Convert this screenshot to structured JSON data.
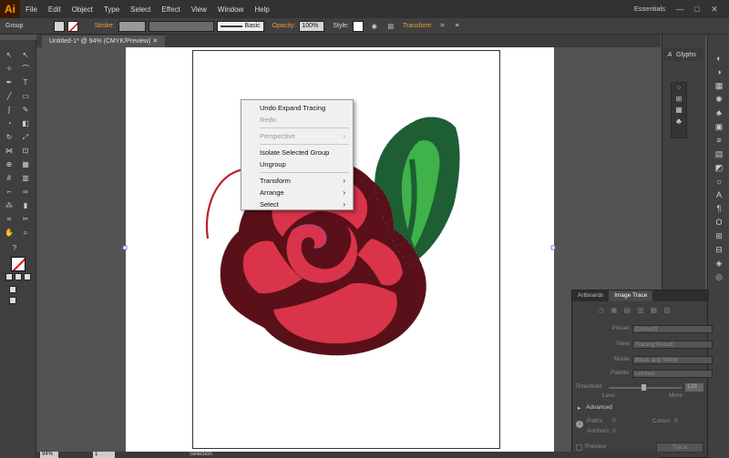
{
  "app": {
    "logo": "Ai",
    "workspace": "Essentials"
  },
  "menu": [
    "File",
    "Edit",
    "Object",
    "Type",
    "Select",
    "Effect",
    "View",
    "Window",
    "Help"
  ],
  "window_controls": [
    "—",
    "□",
    "✕"
  ],
  "control_bar": {
    "selection_type": "Group",
    "stroke_label": "Stroke:",
    "brush_label": "Basic",
    "opacity_label": "Opacity:",
    "opacity_value": "100%",
    "style_label": "Style:",
    "transform_label": "Transform"
  },
  "document_tab": "Untitled-1* @ 94% (CMYK/Preview)",
  "right_panel": {
    "glyphs_label": "Glyphs"
  },
  "context_menu": {
    "items": [
      {
        "label": "Undo Expand Tracing",
        "enabled": true
      },
      {
        "label": "Redo",
        "enabled": false
      },
      {
        "label": "Perspective",
        "enabled": false,
        "submenu": true
      },
      {
        "label": "Isolate Selected Group",
        "enabled": true
      },
      {
        "label": "Ungroup",
        "enabled": true
      },
      {
        "label": "Transform",
        "enabled": true,
        "submenu": true
      },
      {
        "label": "Arrange",
        "enabled": true,
        "submenu": true
      },
      {
        "label": "Select",
        "enabled": true,
        "submenu": true
      }
    ]
  },
  "image_trace_panel": {
    "tabs": [
      "Artboards",
      "Image Trace"
    ],
    "preset_label": "Preset:",
    "preset_value": "[Default]",
    "view_label": "View:",
    "view_value": "Tracing Result",
    "mode_label": "Mode:",
    "mode_value": "Black and White",
    "palette_label": "Palette:",
    "palette_value": "Limited",
    "threshold_label": "Threshold:",
    "threshold_value": "128",
    "less_label": "Less",
    "more_label": "More",
    "advanced_label": "Advanced",
    "paths_label": "Paths:",
    "paths_value": "0",
    "colors_label": "Colors:",
    "colors_value": "0",
    "anchors_label": "Anchors:",
    "anchors_value": "0",
    "preview_label": "Preview",
    "trace_button": "Trace"
  },
  "status_bar": {
    "zoom": "94%",
    "page": "1",
    "tool": "Selection"
  },
  "colors": {
    "rose_petal": "#d9344a",
    "rose_outline": "#5a1018",
    "leaf_dark": "#1e5e33",
    "leaf_light": "#3fb24a",
    "annotation_arrow": "#c0202a",
    "path_anchor": "#4a6ee0"
  }
}
